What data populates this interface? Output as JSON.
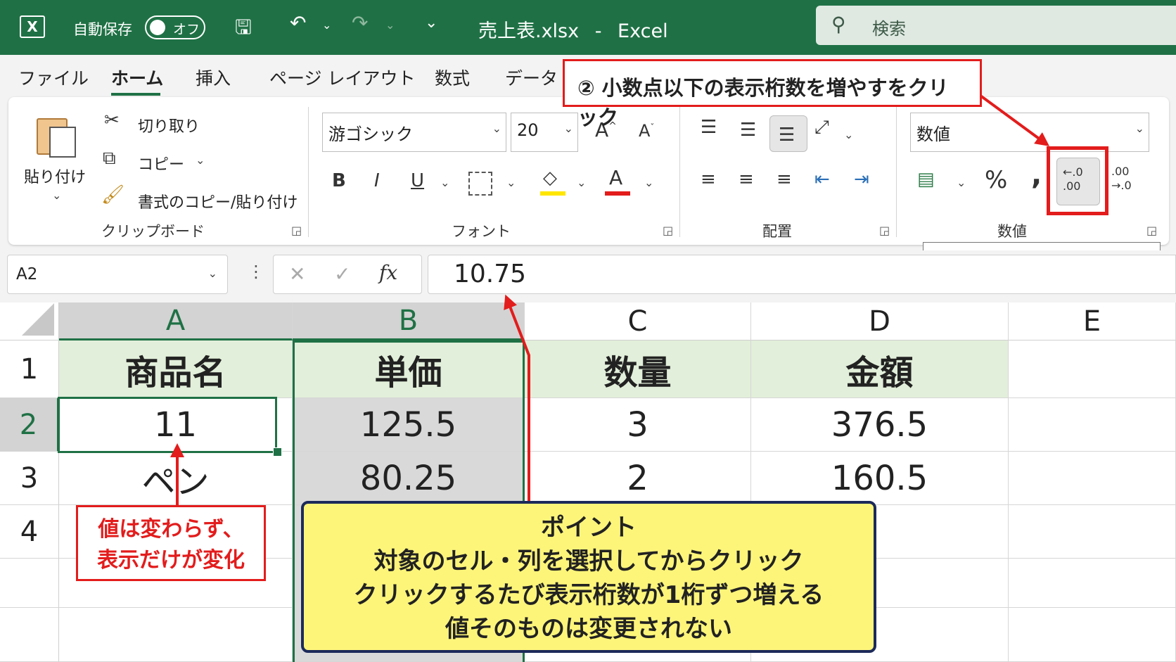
{
  "titlebar": {
    "autosave_label": "自動保存",
    "autosave_state": "オフ",
    "filename": "売上表.xlsx",
    "separator": "-",
    "app": "Excel",
    "search_placeholder": "検索"
  },
  "menu": [
    "ファイル",
    "ホーム",
    "挿入",
    "ページ レイアウト",
    "数式",
    "データ"
  ],
  "clipboard": {
    "paste": "貼り付け",
    "cut": "切り取り",
    "copy": "コピー",
    "format_painter": "書式のコピー/貼り付け",
    "group_label": "クリップボード"
  },
  "font": {
    "name": "游ゴシック",
    "size": "20",
    "bold": "B",
    "italic": "I",
    "underline": "U",
    "group_label": "フォント"
  },
  "alignment": {
    "group_label": "配置"
  },
  "number": {
    "format": "数値",
    "percent": "%",
    "comma": ",",
    "increase_decimal": "←.0 .00",
    "decrease_decimal": ".00 →.0",
    "group_label": "数値",
    "tooltip": "小数点以下の表示桁数を増やす"
  },
  "formula_bar": {
    "name_box": "A2",
    "fx": "fx",
    "value": "10.75"
  },
  "grid": {
    "columns": [
      "A",
      "B",
      "C",
      "D",
      "E"
    ],
    "rows": [
      "1",
      "2",
      "3",
      "4"
    ],
    "header_row": [
      "商品名",
      "単価",
      "数量",
      "金額"
    ],
    "row2": [
      "11",
      "125.5",
      "3",
      "376.5"
    ],
    "row3": [
      "ペン",
      "80.25",
      "2",
      "160.5"
    ]
  },
  "annotations": {
    "step2": "② 小数点以下の表示桁数を増やすをクリック",
    "value_note_line1": "値は変わらず、",
    "value_note_line2": "表示だけが変化",
    "point_title": "ポイント",
    "point_line1": "対象のセル・列を選択してからクリック",
    "point_line2": "クリックするたび表示桁数が1桁ずつ増える",
    "point_line3": "値そのものは変更されない"
  },
  "colors": {
    "excel_green": "#1f7145",
    "header_fill": "#e2efda",
    "callout_red": "#e31c1c",
    "callout_yellow": "#fdf57a",
    "callout_border_navy": "#1c2a5a"
  }
}
